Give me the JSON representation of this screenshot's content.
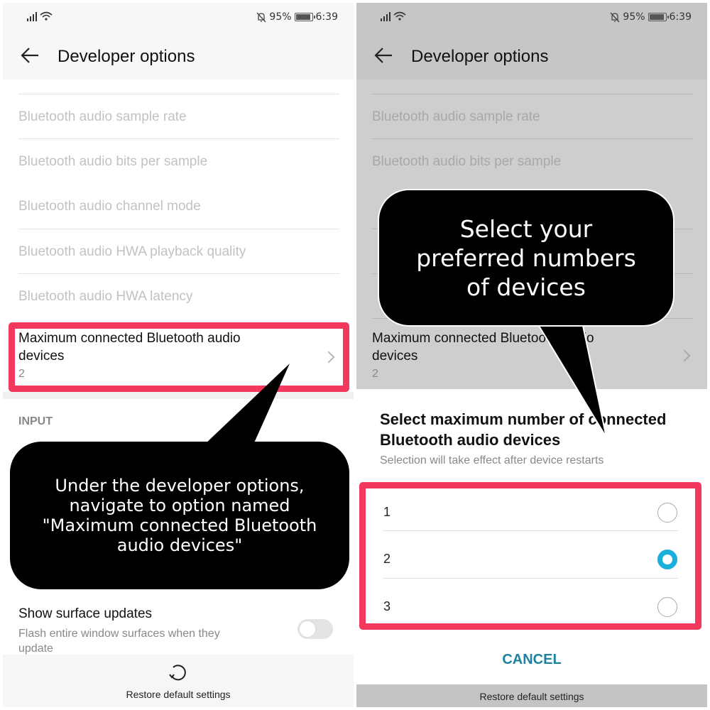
{
  "status_bar": {
    "battery_percent": "95%",
    "battery_level": 0.95,
    "time": "6:39",
    "icons": [
      "signal-icon",
      "wifi-icon",
      "bell-off-icon",
      "battery-icon"
    ]
  },
  "left_screen": {
    "title": "Developer options",
    "disabled_items": [
      "Bluetooth audio sample rate",
      "Bluetooth audio bits per sample",
      "Bluetooth audio channel mode",
      "Bluetooth audio HWA playback quality",
      "Bluetooth audio HWA latency"
    ],
    "highlight_item": {
      "title": "Maximum connected Bluetooth audio devices",
      "value": "2"
    },
    "section_header": "INPUT",
    "callout": "Under the developer options,\nnavigate to option named\n\"Maximum connected Bluetooth\naudio devices\"",
    "surface_updates": {
      "title": "Show surface updates",
      "subtitle": "Flash entire window surfaces when they update",
      "enabled": false
    },
    "restore_label": "Restore default settings"
  },
  "right_screen": {
    "title": "Developer options",
    "disabled_items": [
      "Bluetooth audio sample rate",
      "Bluetooth audio bits per sample"
    ],
    "highlight_item": {
      "title": "Maximum connected Bluetooth audio devices",
      "value": "2"
    },
    "callout": "Select your\npreferred numbers\nof devices",
    "dialog": {
      "title": "Select maximum number of connected Bluetooth audio devices",
      "subtitle": "Selection will take effect after device restarts",
      "options": [
        {
          "label": "1",
          "selected": false
        },
        {
          "label": "2",
          "selected": true
        },
        {
          "label": "3",
          "selected": false
        }
      ],
      "cancel_label": "CANCEL"
    },
    "restore_label": "Restore default settings"
  },
  "colors": {
    "highlight_border": "#f2395d",
    "radio_selected": "#1ab0dc",
    "cancel_text": "#1b83a0"
  }
}
